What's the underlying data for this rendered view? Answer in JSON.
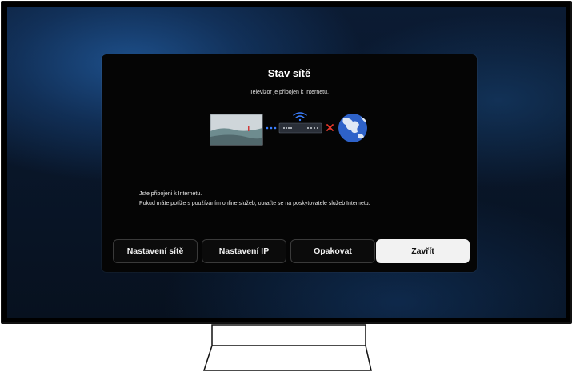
{
  "dialog": {
    "title": "Stav sítě",
    "subtitle": "Televizor je připojen k Internetu.",
    "info_line1": "Jste připojeni k Internetu.",
    "info_line2": "Pokud máte potíže s používáním online služeb, obraťte se na poskytovatele služeb Internetu."
  },
  "diagram": {
    "tv_icon": "tv-screen-icon",
    "wifi_icon": "wifi-icon",
    "router_icon": "router-icon",
    "status_icon": "x-mark-icon",
    "globe_icon": "globe-icon",
    "x_color": "#e8392c",
    "link_color": "#3b7fff"
  },
  "buttons": {
    "network_settings": "Nastavení sítě",
    "ip_settings": "Nastavení IP",
    "retry": "Opakovat",
    "close": "Zavřít"
  }
}
